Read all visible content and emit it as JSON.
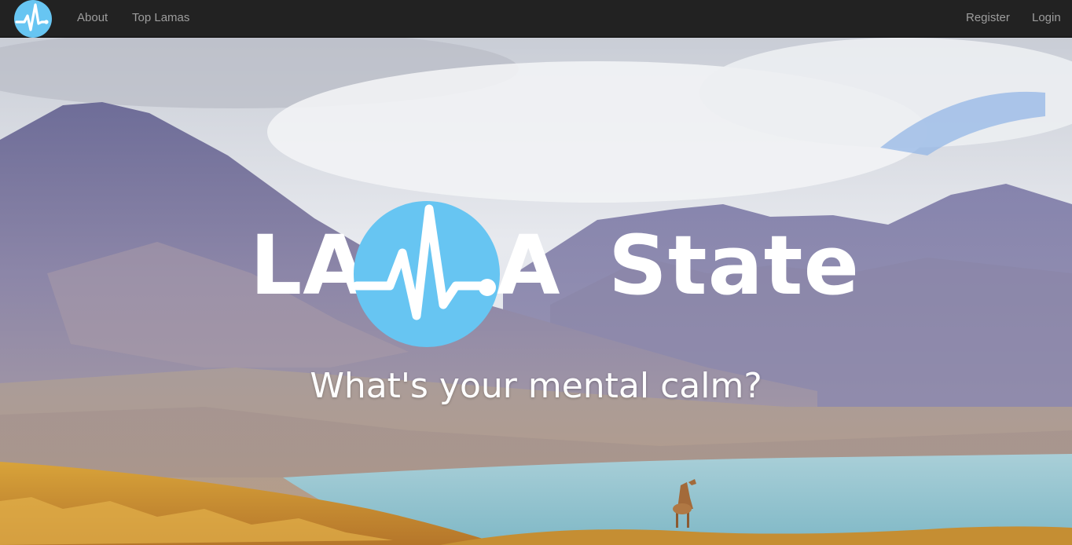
{
  "navbar": {
    "logo_icon": "heartbeat-icon",
    "about_label": "About",
    "top_lamas_label": "Top Lamas",
    "register_label": "Register",
    "login_label": "Login"
  },
  "hero": {
    "brand_part1": "LA",
    "brand_part2": "A",
    "brand_part3": "State",
    "brand_icon": "heartbeat-icon",
    "tagline": "What's your mental calm?"
  },
  "colors": {
    "navbar_bg": "#222222",
    "nav_text": "#9d9d9d",
    "brand_accent": "#67c5f2",
    "brand_text": "#ffffff"
  }
}
